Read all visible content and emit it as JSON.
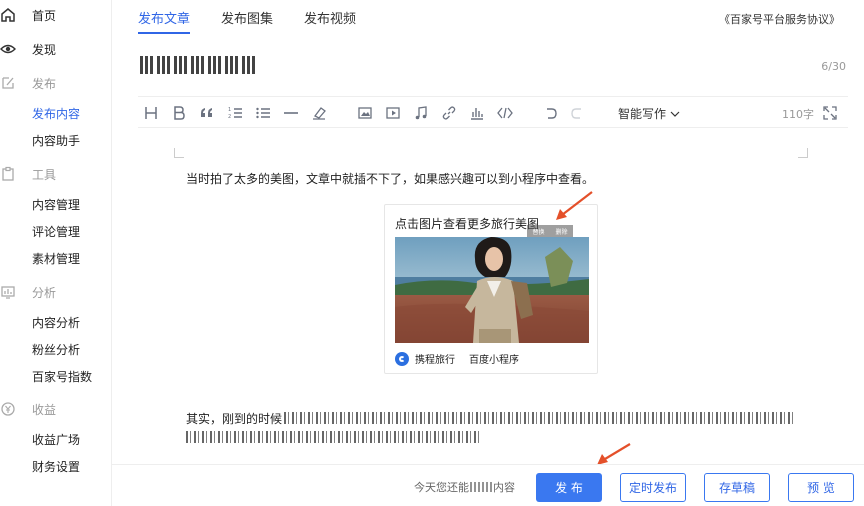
{
  "sidebar": {
    "home": "首页",
    "discover": "发现",
    "publish": {
      "group": "发布",
      "items": [
        "发布内容",
        "内容助手"
      ]
    },
    "tools": {
      "group": "工具",
      "items": [
        "内容管理",
        "评论管理",
        "素材管理"
      ]
    },
    "analysis": {
      "group": "分析",
      "items": [
        "内容分析",
        "粉丝分析",
        "百家号指数"
      ]
    },
    "income": {
      "group": "收益",
      "items": [
        "收益广场",
        "财务设置"
      ]
    }
  },
  "tabs": [
    "发布文章",
    "发布图集",
    "发布视频"
  ],
  "agreement": "《百家号平台服务协议》",
  "title": {
    "counter": "6/30"
  },
  "toolbar": {
    "smart_writing": "智能写作",
    "word_count": "110字"
  },
  "editor": {
    "paragraph1": "当时拍了太多的美图，文章中就插不下了，如果感兴趣可以到小程序中查看。",
    "card": {
      "title": "点击图片查看更多旅行美图",
      "ops": [
        "替换",
        "删除"
      ],
      "app_name": "携程旅行",
      "platform": "百度小程序"
    },
    "paragraph2_start": "其实，刚到的时候"
  },
  "footer": {
    "remain_prefix": "今天您还能",
    "remain_suffix": "内容",
    "publish": "发 布",
    "schedule": "定时发布",
    "draft": "存草稿",
    "preview": "预 览"
  },
  "colors": {
    "accent": "#3066e6",
    "button": "#3a78f0",
    "arrow": "#e4502a"
  }
}
